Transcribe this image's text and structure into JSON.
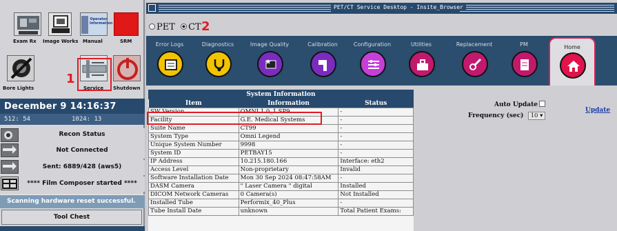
{
  "left_panel": {
    "top_buttons": [
      {
        "label": "Exam Rx",
        "icon": "exam-rx-icon"
      },
      {
        "label": "Image Works",
        "icon": "image-works-icon"
      },
      {
        "label": "Manual",
        "icon": "operator-information-icon",
        "icon_text": "Operator Information"
      },
      {
        "label": "SRM",
        "icon": "srm-red-square-icon"
      }
    ],
    "second_buttons": [
      {
        "label": "Bore Lights",
        "icon": "bore-lights-off-icon"
      },
      {
        "label": "Service",
        "icon": "service-wrench-icon"
      },
      {
        "label": "Shutdown",
        "icon": "power-shutdown-icon"
      }
    ],
    "datetime": "December  9 14:16:37",
    "coord_left": "512:  54",
    "coord_right": "1024:  13",
    "status_rows": [
      {
        "icon": "recon-status-icon",
        "text": "Recon Status"
      },
      {
        "icon": "connection-arrows-icon",
        "text": "Not Connected"
      },
      {
        "icon": "connection-arrows-icon",
        "text": "Sent: 6889/428 (aws5)"
      },
      {
        "icon": "film-composer-icon",
        "text": "**** Film Composer started ****"
      }
    ],
    "scan_message": "Scanning hardware reset successful.",
    "tool_chest": "Tool Chest"
  },
  "window": {
    "title": "PET/CT Service Desktop - Insite_Browser",
    "modality_pet": "PET",
    "modality_ct": "CT",
    "modality_selected": "CT"
  },
  "tabs": [
    {
      "label": "Error Logs",
      "color": "#f2c400",
      "icon": "error-logs-icon"
    },
    {
      "label": "Diagnostics",
      "color": "#f2c400",
      "icon": "stethoscope-icon"
    },
    {
      "label": "Image Quality",
      "color": "#7b2cbf",
      "icon": "image-quality-icon"
    },
    {
      "label": "Calibration",
      "color": "#7b2cbf",
      "icon": "calibration-icon"
    },
    {
      "label": "Configuration",
      "color": "#c63fd9",
      "icon": "configuration-icon"
    },
    {
      "label": "Utilities",
      "color": "#c2196e",
      "icon": "utilities-toolbox-icon"
    },
    {
      "label": "Replacement",
      "color": "#c2196e",
      "icon": "replacement-icon"
    },
    {
      "label": "PM",
      "color": "#c2196e",
      "icon": "pm-checklist-icon"
    },
    {
      "label": "Home",
      "color": "#e0134a",
      "icon": "home-icon",
      "selected": true
    }
  ],
  "system_info": {
    "title": "System Information",
    "columns": [
      "Item",
      "Information",
      "Status"
    ],
    "rows": [
      [
        "SW Version",
        "OMNI 1.0_1.SP9",
        "-"
      ],
      [
        "Facility",
        "G.E. Medical Systems",
        "-"
      ],
      [
        "Suite Name",
        "CT99",
        "-"
      ],
      [
        "System Type",
        "Omni Legend",
        "-"
      ],
      [
        "Unique System Number",
        "9998",
        "-"
      ],
      [
        "System ID",
        "PETBAY15",
        "-"
      ],
      [
        "IP Address",
        "10.215.180.166",
        "Interface: eth2"
      ],
      [
        "Access Level",
        "Non-proprietary",
        "Invalid"
      ],
      [
        "Software Installation Date",
        "Mon 30 Sep 2024 08:47:58AM",
        "-"
      ],
      [
        "DASM Camera",
        "\" Laser Camera \" digital",
        "Installed"
      ],
      [
        "DICOM Network Cameras",
        "0 Camera(s)",
        "Not Installed"
      ],
      [
        "Installed Tube",
        "Performix_40_Plus",
        "-"
      ],
      [
        "Tube Install Date",
        "unknown",
        "Total Patient Exams:"
      ]
    ]
  },
  "controls": {
    "auto_update_label": "Auto Update",
    "frequency_label": "Frequency (sec)",
    "frequency_value": "10",
    "update_link": "Update"
  },
  "annotations": {
    "callout_1": "1",
    "callout_2": "2"
  }
}
